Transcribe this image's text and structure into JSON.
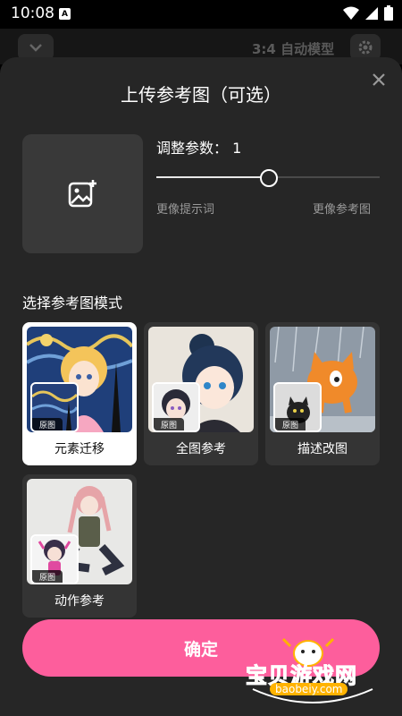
{
  "status_bar": {
    "time": "10:08",
    "notification_icon": "A"
  },
  "background": {
    "ratio_model": "3:4  自动模型"
  },
  "sheet": {
    "title": "上传参考图（可选）",
    "param_label": "调整参数：  1",
    "param_value": 1,
    "slider_fraction": 0.5,
    "hint_left": "更像提示词",
    "hint_right": "更像参考图"
  },
  "modes": {
    "section_title": "选择参考图模式",
    "original_tag": "原图",
    "items": [
      {
        "label": "元素迁移",
        "selected": true
      },
      {
        "label": "全图参考",
        "selected": false
      },
      {
        "label": "描述改图",
        "selected": false
      },
      {
        "label": "动作参考",
        "selected": false
      }
    ]
  },
  "confirm_label": "确定",
  "watermark": {
    "text": "宝贝游戏网",
    "url": "baobeiy.com"
  },
  "colors": {
    "accent": "#fd5e9c",
    "sheet": "#262626",
    "card": "#343434"
  },
  "icons": [
    "add-image-icon",
    "close-icon",
    "chevron-down-icon",
    "gear-icon",
    "wifi-icon",
    "signal-icon",
    "battery-icon"
  ]
}
